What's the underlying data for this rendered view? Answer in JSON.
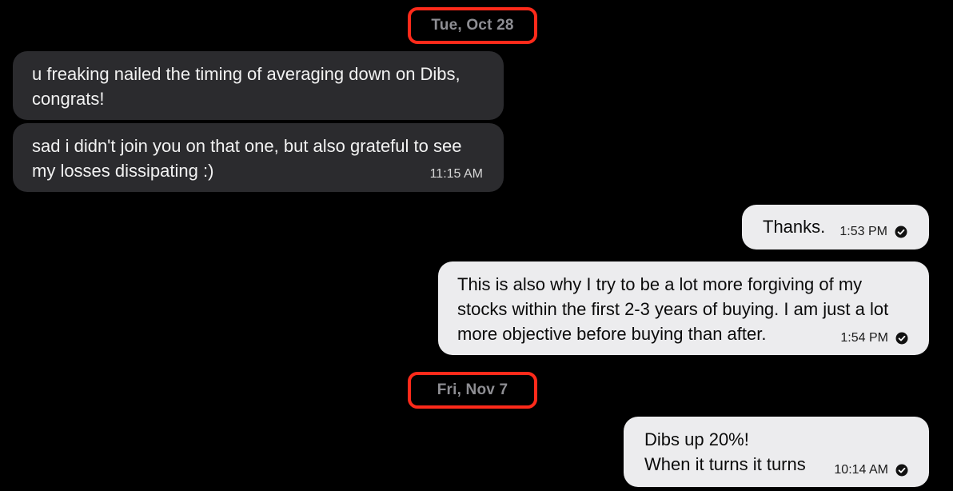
{
  "dates": [
    "Tue, Oct 28",
    "Fri, Nov 7"
  ],
  "messages": [
    {
      "direction": "incoming",
      "text": "u freaking nailed the timing of averaging down on Dibs, congrats!"
    },
    {
      "direction": "incoming",
      "text": "sad i didn't join you on that one, but also grateful to see my losses dissipating :)",
      "time": "11:15 AM"
    },
    {
      "direction": "outgoing",
      "text": "Thanks.",
      "time": "1:53 PM",
      "status_icon": "read-check-icon"
    },
    {
      "direction": "outgoing",
      "text": "This is also why I try to be a lot more forgiving of my stocks within the first 2-3 years of buying. I am just a lot more objective before buying than after.",
      "time": "1:54 PM",
      "status_icon": "read-check-icon"
    },
    {
      "direction": "outgoing",
      "lines": [
        "Dibs up 20%!",
        "When it turns it turns"
      ],
      "time": "10:14 AM",
      "status_icon": "read-check-icon"
    }
  ],
  "colors": {
    "background": "#000000",
    "incoming_bubble": "#2b2b2e",
    "outgoing_bubble": "#ececee",
    "date_text": "#8e8e93",
    "highlight_box": "#ff2a1a"
  }
}
